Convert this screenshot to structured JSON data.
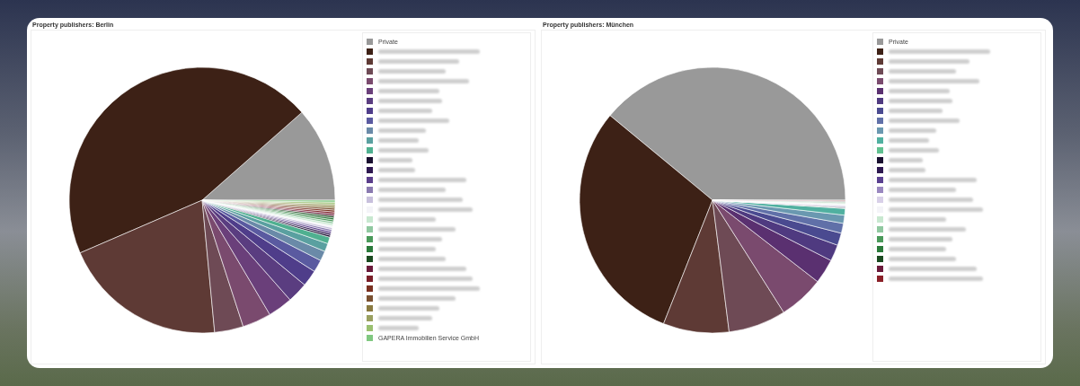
{
  "panels": [
    {
      "title": "Property publishers: Berlin",
      "legend": [
        {
          "label": "Private",
          "color": "#999999"
        },
        {
          "color": "#3d2116"
        },
        {
          "color": "#5e3a35"
        },
        {
          "color": "#6e4a55"
        },
        {
          "color": "#7a4a6e"
        },
        {
          "color": "#6a3f7a"
        },
        {
          "color": "#5a3d80"
        },
        {
          "color": "#4f3d8a"
        },
        {
          "color": "#5a5aa0"
        },
        {
          "color": "#6a8aa8"
        },
        {
          "color": "#5aa0a0"
        },
        {
          "color": "#4fb090"
        },
        {
          "color": "#1a1030"
        },
        {
          "color": "#2e1850"
        },
        {
          "color": "#5a3d8a"
        },
        {
          "color": "#8a7ab0"
        },
        {
          "color": "#c8c0dc"
        },
        {
          "color": "#f4f4f8"
        },
        {
          "color": "#c8e8d0"
        },
        {
          "color": "#90c8a0"
        },
        {
          "color": "#4a9a5a"
        },
        {
          "color": "#2a7a3a"
        },
        {
          "color": "#1a4a20"
        },
        {
          "color": "#6a1a3a"
        },
        {
          "color": "#7a1e28"
        },
        {
          "color": "#7a3020"
        },
        {
          "color": "#7a5030"
        },
        {
          "color": "#8a7a40"
        },
        {
          "color": "#9aa060"
        },
        {
          "color": "#9ac070"
        },
        {
          "label": "GAPERA Immobilien Service GmbH",
          "color": "#80c880"
        }
      ]
    },
    {
      "title": "Property publishers: München",
      "legend": [
        {
          "label": "Private",
          "color": "#999999"
        },
        {
          "color": "#3d2116"
        },
        {
          "color": "#5e3a35"
        },
        {
          "color": "#6e4a55"
        },
        {
          "color": "#7a4a6e"
        },
        {
          "color": "#5a3070"
        },
        {
          "color": "#4f3a80"
        },
        {
          "color": "#4a4a90"
        },
        {
          "color": "#6070a8"
        },
        {
          "color": "#6a98b0"
        },
        {
          "color": "#50b0a0"
        },
        {
          "color": "#60c090"
        },
        {
          "color": "#1a1030"
        },
        {
          "color": "#2e1850"
        },
        {
          "color": "#5a4090"
        },
        {
          "color": "#9a88c0"
        },
        {
          "color": "#d8d0e8"
        },
        {
          "color": "#f4f4f8"
        },
        {
          "color": "#c8e8d0"
        },
        {
          "color": "#90c8a0"
        },
        {
          "color": "#4a9a5a"
        },
        {
          "color": "#2a7a3a"
        },
        {
          "color": "#1a4a20"
        },
        {
          "color": "#6a1a3a"
        },
        {
          "color": "#8a2028"
        }
      ]
    }
  ]
}
